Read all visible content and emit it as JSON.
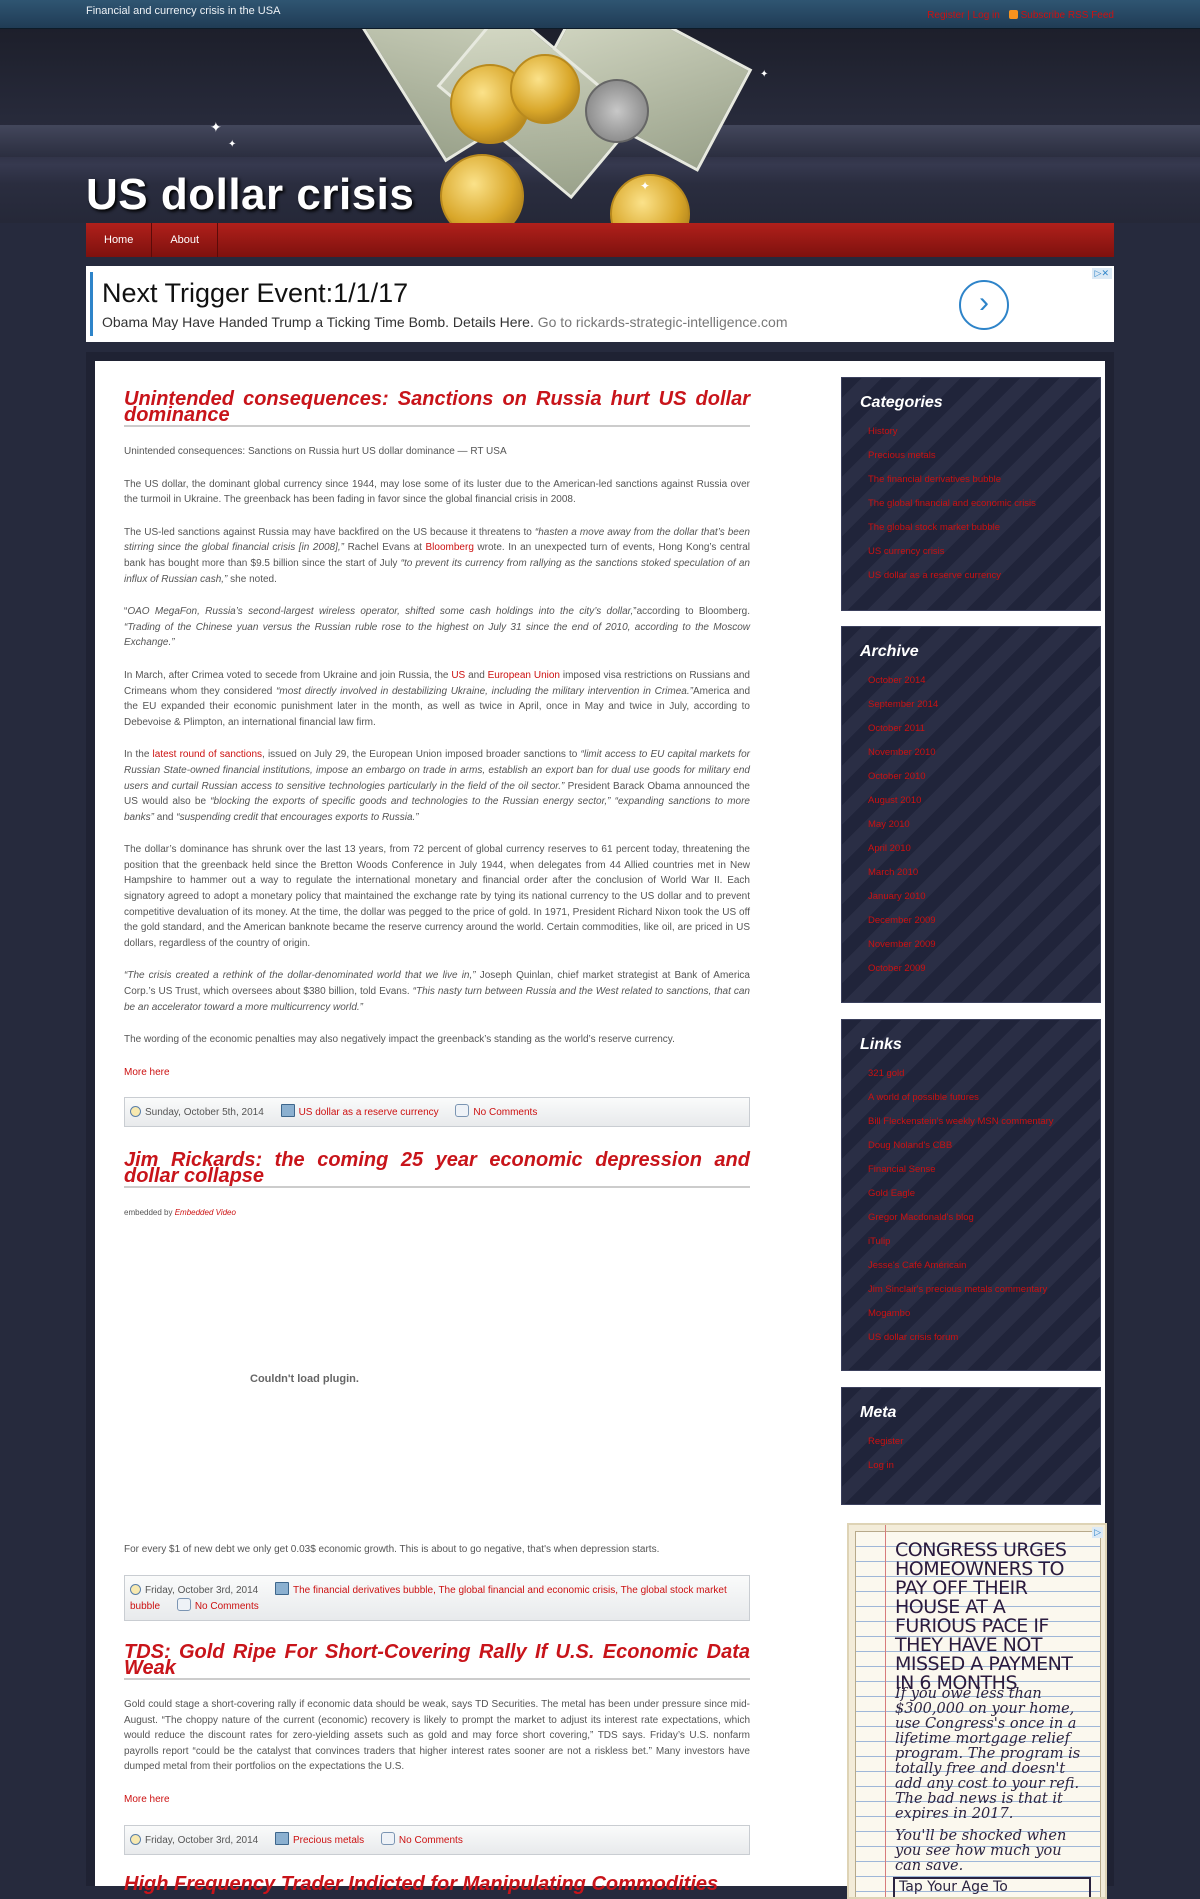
{
  "topbar": {
    "tagline": "Financial and currency crisis in the USA",
    "register": "Register",
    "sep": "|",
    "login": "Log in",
    "rss": "Subscribe RSS Feed"
  },
  "site": {
    "title": "US dollar crisis"
  },
  "nav": {
    "home": "Home",
    "about": "About"
  },
  "ad_banner": {
    "headline": "Next Trigger Event:1/1/17",
    "text": "Obama May Have Handed Trump a Ticking Time Bomb. Details Here.",
    "url": "Go to rickards-strategic-intelligence.com",
    "arrow": "›",
    "choices": "▷✕"
  },
  "posts": [
    {
      "title": "Unintended consequences: Sanctions on Russia hurt US dollar dominance",
      "p1": "Unintended consequences: Sanctions on Russia hurt US dollar dominance — RT USA",
      "p2": "The US dollar, the dominant global currency since 1944, may lose some of its luster due to the American-led sanctions against Russia over the turmoil in Ukraine. The greenback has been fading in favor since the global financial crisis in 2008.",
      "p3a": "The US-led sanctions against Russia may have backfired on the US because it threatens to ",
      "p3b": "“hasten a move away from the dollar that’s been stirring since the global financial crisis [in 2008],”",
      "p3c": " Rachel Evans at ",
      "p3link": "Bloomberg",
      "p3d": " wrote. In an unexpected turn of events, Hong Kong’s central bank has bought more than $9.5 billion since the start of July ",
      "p3e": "“to prevent its currency from rallying as the sanctions stoked speculation of an influx of Russian cash,”",
      "p3f": " she noted.",
      "p4a": "“",
      "p4b": "OAO MegaFon, Russia’s second-largest wireless operator, shifted some cash holdings into the city’s dollar,",
      "p4c": "”according to Bloomberg. ",
      "p4d": "“Trading of the Chinese yuan versus the Russian ruble rose to the highest on July 31 since the end of 2010, according to the Moscow Exchange.”",
      "p5a": "In March, after Crimea voted to secede from Ukraine and join Russia, the ",
      "p5link1": "US",
      "p5b": " and ",
      "p5link2": "European Union",
      "p5c": " imposed visa restrictions on Russians and Crimeans whom they considered ",
      "p5d": "“most directly involved in destabilizing Ukraine, including the military intervention in Crimea.”",
      "p5e": "America and the EU expanded their economic punishment later in the month, as well as twice in April, once in May and twice in July, according to Debevoise & Plimpton, an international financial law firm.",
      "p6a": "In the ",
      "p6link": "latest round of sanctions",
      "p6b": ", issued on July 29, the European Union imposed broader sanctions to ",
      "p6c": "“limit access to EU capital markets for Russian State-owned financial institutions, impose an embargo on trade in arms, establish an export ban for dual use goods for military end users and curtail Russian access to sensitive technologies particularly in the field of the oil sector.”",
      "p6d": " President Barack Obama announced the US would also be ",
      "p6e": "“blocking the exports of specific goods and technologies to the Russian energy sector,” “expanding sanctions to more banks”",
      "p6f": " and ",
      "p6g": "“suspending credit that encourages exports to Russia.”",
      "p7": "The dollar’s dominance has shrunk over the last 13 years, from 72 percent of global currency reserves to 61 percent today, threatening the position that the greenback held since the Bretton Woods Conference in July 1944, when delegates from 44 Allied countries met in New Hampshire to hammer out a way to regulate the international monetary and financial order after the conclusion of World War II. Each signatory agreed to adopt a monetary policy that maintained the exchange rate by tying its national currency to the US dollar and to prevent competitive devaluation of its money. At the time, the dollar was pegged to the price of gold. In 1971, President Richard Nixon took the US off the gold standard, and the American banknote became the reserve currency around the world. Certain commodities, like oil, are priced in US dollars, regardless of the country of origin.",
      "p8a": "“The crisis created a rethink of the dollar-denominated world that we live in,”",
      "p8b": " Joseph Quinlan, chief market strategist at Bank of America Corp.’s US Trust, which oversees about $380 billion, told Evans. ",
      "p8c": "“This nasty turn between Russia and the West related to sanctions, that can be an accelerator toward a more multicurrency world.”",
      "p9": "The wording of the economic penalties may also negatively impact the greenback’s standing as the world’s reserve currency.",
      "more": "More here",
      "date": "Sunday, October 5th, 2014",
      "category": "US dollar as a reserve currency",
      "comments": "No Comments"
    },
    {
      "title": "Jim Rickards: the coming 25 year economic depression and dollar collapse",
      "embedded_prefix": "embedded by ",
      "embedded_link": "Embedded Video",
      "plugin": "Couldn't load plugin.",
      "body": "For every $1 of new debt we only get 0.03$ economic growth. This is about to go negative, that's when depression starts.",
      "date": "Friday, October 3rd, 2014",
      "categories": "The financial derivatives bubble, The global financial and economic crisis, The global stock market bubble",
      "comments": "No Comments"
    },
    {
      "title": "TDS: Gold Ripe For Short-Covering Rally If U.S. Economic Data Weak",
      "body": "Gold could stage a short-covering rally if economic data should be weak, says TD Securities. The metal has been under pressure since mid-August. “The choppy nature of the current (economic) recovery is likely to prompt the market to adjust its interest rate expectations, which would reduce the discount rates for zero-yielding assets such as gold and may force short covering,” TDS says. Friday’s U.S. nonfarm payrolls report “could be the catalyst that convinces traders that higher interest rates sooner are not a riskless bet.” Many investors have dumped metal from their portfolios on the expectations the U.S.",
      "more": "More here",
      "date": "Friday, October 3rd, 2014",
      "category": "Precious metals",
      "comments": "No Comments"
    },
    {
      "title": "High Frequency Trader Indicted for Manipulating Commodities"
    }
  ],
  "sidebar": {
    "categories": {
      "title": "Categories",
      "items": [
        "History",
        "Precious metals",
        "The financial derivatives bubble",
        "The global financial and economic crisis",
        "The global stock market bubble",
        "US currency crisis",
        "US dollar as a reserve currency"
      ]
    },
    "archive": {
      "title": "Archive",
      "items": [
        "October 2014",
        "September 2014",
        "October 2011",
        "November 2010",
        "October 2010",
        "August 2010",
        "May 2010",
        "April 2010",
        "March 2010",
        "January 2010",
        "December 2009",
        "November 2009",
        "October 2009"
      ]
    },
    "links": {
      "title": "Links",
      "items": [
        "321 gold",
        "A world of possible futures",
        "Bill Fleckenstein's weekly MSN commentary",
        "Doug Noland's CBB",
        "Financial Sense",
        "Gold Eagle",
        "Gregor Macdonald's blog",
        "iTulip",
        "Jesse's Café Américain",
        "Jim Sinclair's precious metals commentary",
        "Mogambo",
        "US dollar crisis forum"
      ]
    },
    "meta": {
      "title": "Meta",
      "items": [
        "Register",
        "Log in"
      ]
    }
  },
  "side_ad": {
    "headline": "CONGRESS URGES HOMEOWNERS TO PAY OFF THEIR HOUSE AT A FURIOUS PACE IF THEY HAVE NOT MISSED A PAYMENT IN 6 MONTHS",
    "text1": "If you owe less than $300,000 on your home, use Congress's once in a lifetime mortgage relief program. The program is totally free and doesn't add any cost to your refi. The bad news is that it expires in 2017.",
    "text2": "You'll be shocked when you see how much you can save.",
    "cta": "Tap Your Age To",
    "chip": "▷"
  }
}
